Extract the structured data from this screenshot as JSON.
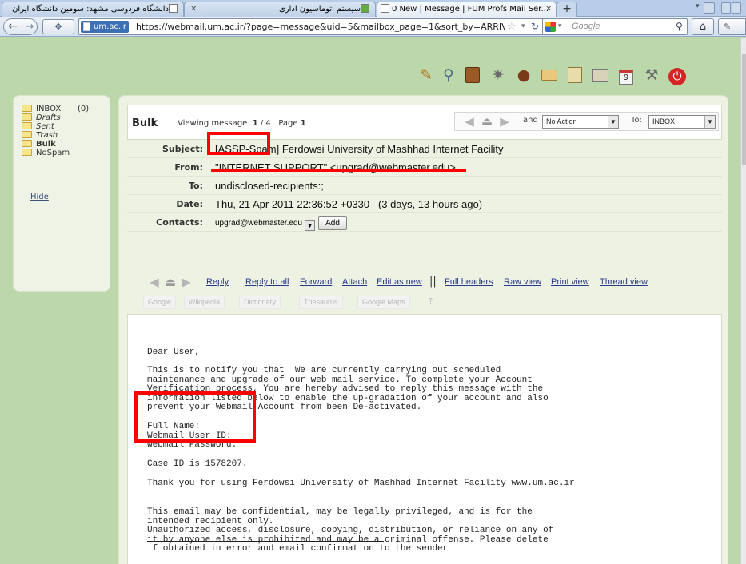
{
  "colors": {
    "page_bg": "#bcd7a9",
    "link": "#2a3a8a",
    "annotation": "#ff0000"
  },
  "browser": {
    "tabs": [
      {
        "label": "دانشگاه فردوسی مشهد: سومین دانشگاه ایران",
        "favicon": "page-icon"
      },
      {
        "label": "سیستم اتوماسیون اداری",
        "favicon": "green-grid-icon"
      },
      {
        "label": "0 New | Message | FUM Profs Mail Ser...",
        "favicon": "page-icon",
        "active": true
      }
    ],
    "new_tab": "+",
    "url_domain": "um.ac.ir",
    "url": "https://webmail.um.ac.ir/?page=message&uid=5&mailbox_page=1&sort_by=ARRIVAL&filter",
    "search_placeholder": "Google"
  },
  "toolbar_icons": [
    "compose-pencil-icon",
    "search-magnifier-icon",
    "notes-book-icon",
    "settings-gear-icon",
    "contacts-person-icon",
    "folders-icon",
    "filter-book-icon",
    "address-book-icon",
    "calendar-icon",
    "tools-icon",
    "logout-power-icon"
  ],
  "folders": {
    "items": [
      {
        "label": "INBOX",
        "count": "(0)",
        "style": "normal"
      },
      {
        "label": "Drafts",
        "style": "italic"
      },
      {
        "label": "Sent",
        "style": "italic"
      },
      {
        "label": "Trash",
        "style": "italic"
      },
      {
        "label": "Bulk",
        "style": "bold"
      },
      {
        "label": "NoSpam",
        "style": "normal"
      }
    ],
    "hide": "Hide"
  },
  "message_header": {
    "mailbox": "Bulk",
    "viewing_prefix": "Viewing message",
    "msg_index": "1",
    "msg_total": "/ 4",
    "page_prefix": "Page",
    "page_num": "1",
    "and_label": "and",
    "action_select": "No Action",
    "to_label": "To:",
    "to_select": "INBOX"
  },
  "headers": {
    "subject_label": "Subject:",
    "subject_tag": "[ASSP-Spam]",
    "subject_rest": " Ferdowsi University of Mashhad Internet Facility",
    "from_label": "From:",
    "from_value": "\"INTERNET SUPPORT\" <upgrad@webmaster.edu>",
    "to_label": "To:",
    "to_value": "undisclosed-recipients:;",
    "date_label": "Date:",
    "date_value": "Thu, 21 Apr 2011 22:36:52 +0330   (3 days, 13 hours ago)",
    "contacts_label": "Contacts:",
    "contacts_value": "upgrad@webmaster.edu",
    "add_button": "Add"
  },
  "actions": {
    "reply": "Reply",
    "reply_all": "Reply to all",
    "forward": "Forward",
    "attach": "Attach",
    "edit_as_new": "Edit as new",
    "separator": "||",
    "full_headers": "Full headers",
    "raw_view": "Raw view",
    "print_view": "Print view",
    "thread_view": "Thread view"
  },
  "search_links": {
    "google": "Google",
    "wikipedia": "Wikipedia",
    "dictionary": "Dictionary",
    "thesaurus": "Thesaurus",
    "google_maps": "Google Maps",
    "help": "?"
  },
  "body": {
    "greeting": "Dear User,",
    "paragraph": "This is to notify you that  We are currently carrying out scheduled\nmaintenance and upgrade of our web mail service. To complete your Account\nVerification process, You are hereby advised to reply this message with the\ninformation listed below to enable the up-gradation of your account and also\nprevent your Webmail Account from been De-activated.",
    "fields": "Full Name:\nWebmail User ID:\nwebmail Password:",
    "case_id": "Case ID is 1578207.",
    "thanks": "Thank you for using Ferdowsi University of Mashhad Internet Facility www.um.ac.ir",
    "disclaimer": "This email may be confidential, may be legally privileged, and is for the\nintended recipient only.\nUnauthorized access, disclosure, copying, distribution, or reliance on any of\nit by anyone else is prohibited and may be a criminal offense. Please delete\nif obtained in error and email confirmation to the sender"
  }
}
